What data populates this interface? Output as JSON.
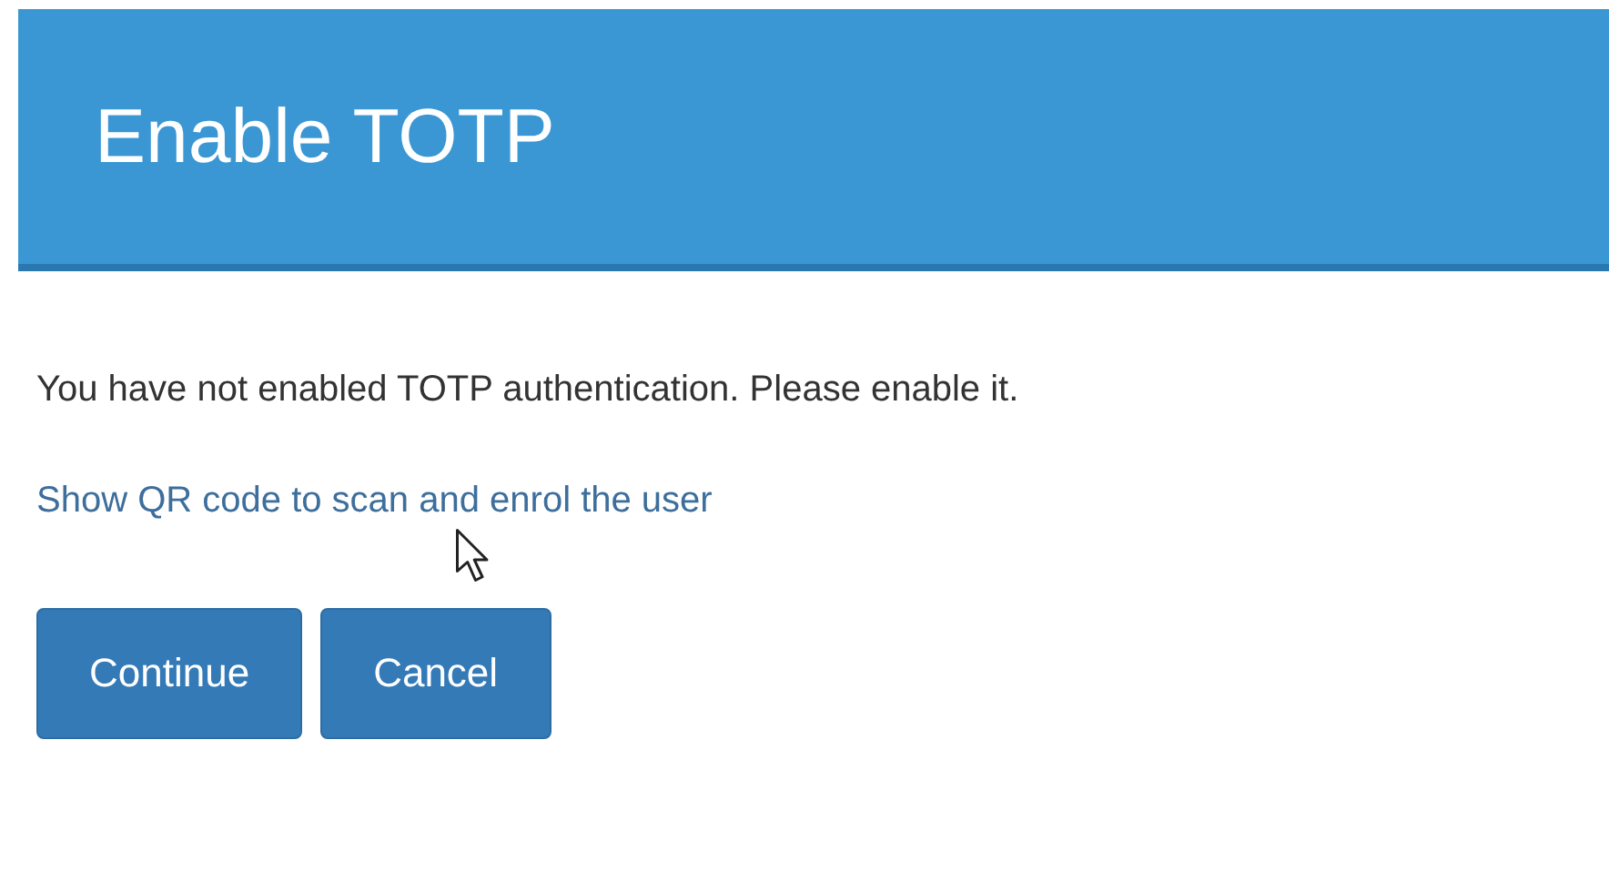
{
  "header": {
    "title": "Enable TOTP"
  },
  "message": "You have not enabled TOTP authentication. Please enable it.",
  "link": "Show QR code to scan and enrol the user",
  "buttons": [
    {
      "label": "Continue"
    },
    {
      "label": "Cancel"
    }
  ]
}
